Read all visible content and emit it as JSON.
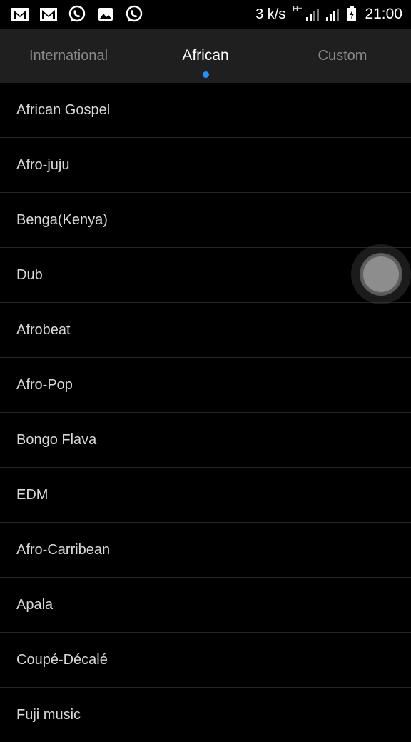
{
  "status_bar": {
    "left_icons": [
      "gmail-icon",
      "gmail-icon",
      "whatsapp-icon",
      "gallery-icon",
      "whatsapp-icon"
    ],
    "network_speed": "3 k/s",
    "network_type": "H+",
    "time": "21:00"
  },
  "tabs": [
    {
      "label": "International",
      "active": false
    },
    {
      "label": "African",
      "active": true
    },
    {
      "label": "Custom",
      "active": false
    }
  ],
  "accent_color": "#1e90ff",
  "list": {
    "items": [
      "African Gospel",
      "Afro-juju",
      "Benga(Kenya)",
      "Dub",
      "Afrobeat",
      "Afro-Pop",
      "Bongo Flava",
      "EDM",
      "Afro-Carribean",
      "Apala",
      "Coupé-Décalé",
      "Fuji music"
    ]
  }
}
